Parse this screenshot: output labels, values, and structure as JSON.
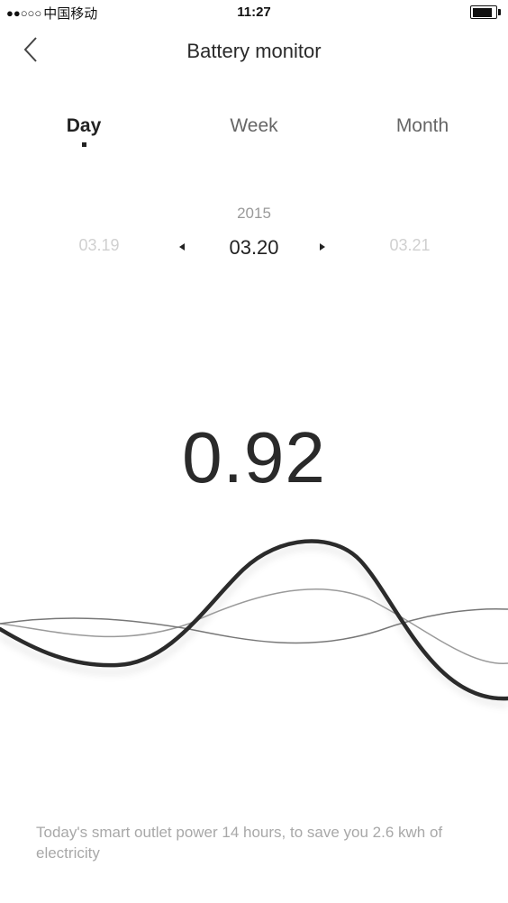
{
  "status_bar": {
    "signal_dots": "●●○○○",
    "carrier": "中国移动",
    "time": "11:27",
    "battery_level": 0.85
  },
  "nav": {
    "title": "Battery monitor"
  },
  "tabs": [
    {
      "label": "Day",
      "active": true
    },
    {
      "label": "Week",
      "active": false
    },
    {
      "label": "Month",
      "active": false
    }
  ],
  "date_picker": {
    "year": "2015",
    "prev": "03.19",
    "current": "03.20",
    "next": "03.21"
  },
  "reading": {
    "value": "0.92"
  },
  "summary": {
    "text": "Today's smart outlet power 14 hours, to save you 2.6 kwh of electricity"
  },
  "colors": {
    "primary_wave": "#2b2b2b",
    "secondary_wave": "#8c8c8c",
    "muted_text": "#a8a8a8"
  }
}
